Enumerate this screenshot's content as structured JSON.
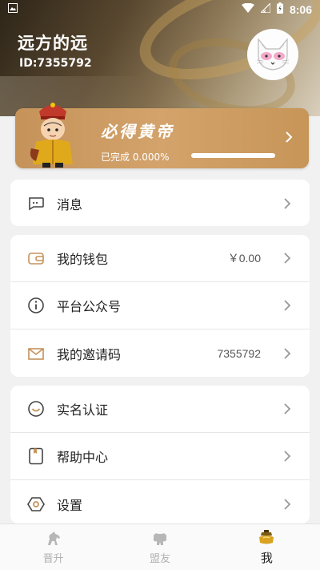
{
  "status_bar": {
    "time": "8:06"
  },
  "profile": {
    "name": "远方的远",
    "id_text": "ID:7355792"
  },
  "emperor_card": {
    "title": "必得黄帝",
    "progress_text": "已完成 0.000%",
    "progress_value": 0.0
  },
  "menu_groups": [
    {
      "items": [
        {
          "label": "消息",
          "value": "",
          "icon": "message-icon"
        }
      ]
    },
    {
      "items": [
        {
          "label": "我的钱包",
          "value": "￥0.00",
          "icon": "wallet-icon"
        },
        {
          "label": "平台公众号",
          "value": "",
          "icon": "info-icon"
        },
        {
          "label": "我的邀请码",
          "value": "7355792",
          "icon": "envelope-icon"
        }
      ]
    },
    {
      "items": [
        {
          "label": "实名认证",
          "value": "",
          "icon": "verify-icon"
        },
        {
          "label": "帮助中心",
          "value": "",
          "icon": "help-book-icon"
        },
        {
          "label": "设置",
          "value": "",
          "icon": "settings-icon"
        }
      ]
    }
  ],
  "tabbar": {
    "tabs": [
      {
        "label": "晋升",
        "icon": "horse-icon",
        "active": false
      },
      {
        "label": "盟友",
        "icon": "ally-icon",
        "active": false
      },
      {
        "label": "我",
        "icon": "gold-ingot-icon",
        "active": true
      }
    ]
  },
  "colors": {
    "accent": "#c5935a",
    "page_bg": "#f1f1f1",
    "icon_stroke": "#444444"
  }
}
